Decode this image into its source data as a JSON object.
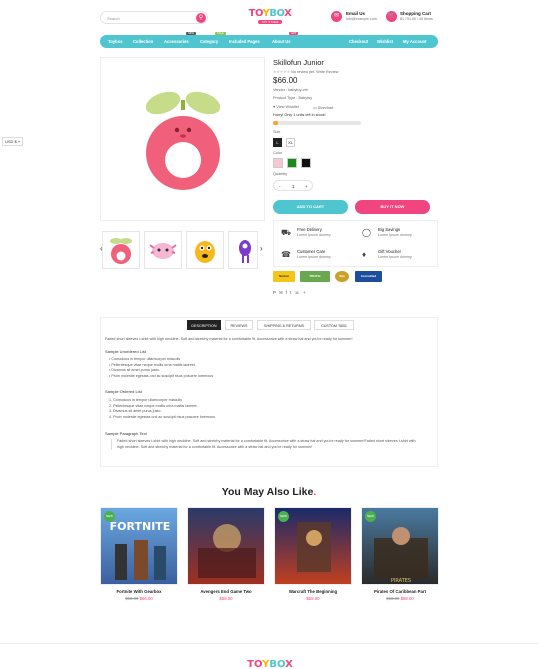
{
  "header": {
    "search_placeholder": "Search",
    "logo_text": "TOYBOX",
    "logo_sub": "TOY STORE",
    "email_title": "Email Us",
    "email_value": "info@example.com",
    "cart_title": "Shopping Cart",
    "cart_value": "$1,791.00 / 45 Items"
  },
  "nav": {
    "items": [
      "Toybox",
      "Collection",
      "Accessories",
      "Category",
      "Included Pages",
      "About Us"
    ],
    "badges": {
      "accessories": "NEW",
      "category": "SALE",
      "about": "HOT"
    },
    "right": [
      "Checkout",
      "Wishlist",
      "My Account"
    ]
  },
  "currency": "USD $",
  "product": {
    "title": "Skillofun Junior",
    "review_text": "No review yet. Write Review",
    "price": "$66.00",
    "vendor": "Vendor : babytoy-vtn",
    "type": "Product Type : Babytoy",
    "wishlist": "View Wishlist",
    "sizechart": "Sizechart",
    "hurry": "Hurry! Only 1 units left in stock!",
    "stock_fraction": 0.06,
    "size_label": "Size",
    "sizes": [
      "L",
      "XL"
    ],
    "color_label": "Color",
    "colors": [
      "#f7c8d3",
      "#1a8a1a",
      "#111111"
    ],
    "quantity_label": "Quantity",
    "qty_minus": "-",
    "qty_value": "1",
    "qty_plus": "+",
    "add_to_cart": "ADD TO CART",
    "buy_now": "BUY IT NOW"
  },
  "features": [
    {
      "title": "Free Delivery",
      "text": "Lorem Ipsum dummy"
    },
    {
      "title": "Big Savings",
      "text": "Lorem Ipsum dummy"
    },
    {
      "title": "Customer Care",
      "text": "Lorem Ipsum dummy"
    },
    {
      "title": "Gift Voucher",
      "text": "Lorem Ipsum dummy"
    }
  ],
  "trust_badges": [
    "Norton",
    "TRUSTe",
    "Site Secure",
    "Accredited"
  ],
  "tabs": [
    "DESCRIPTION",
    "REVIEWS",
    "SHIPPING & RETURNS",
    "CUSTOM TAB1"
  ],
  "description": {
    "intro": "Faded short sleeves t-shirt with high neckline. Soft and stretchy material for a comfortable fit. Accessorize with a straw hat and you're ready for summer!",
    "ul_title": "Sample Unordered List",
    "ul": [
      "Comodous in tempor ullamcorper miaculis",
      "Pellentesque vitae neque mollis urna mattis laoreet.",
      "Divamus sit amet purus justo.",
      "Proin molestie egestas orci ac suscipit risus posuere loremous"
    ],
    "ol_title": "Sample Ordered List",
    "ol": [
      "Comodous in tempor ullamcorper miaculis",
      "Pellentesque vitae neque mollis urna mattis laoreet.",
      "Divamus sit amet purus justo.",
      "Proin molestie egestas orci ac suscipit risus posuere loremous"
    ],
    "p_title": "Sample Paragraph Text",
    "p": "Faded short sleeves t-shirt with high neckline. Soft and stretchy material for a comfortable fit. Accessorize with a straw hat and you're ready for summer!Faded short sleeves t-shirt with high neckline. Soft and stretchy material for a comfortable fit. Accessorize with a straw hat and you're ready for summer!"
  },
  "related": {
    "title": "You May Also Like",
    "items": [
      {
        "name": "Fortnite With Gearbox",
        "old": "$68.00",
        "price": "$66.00",
        "badge": "NEW"
      },
      {
        "name": "Avengers End Game Two",
        "old": "",
        "price": "$58.00",
        "badge": ""
      },
      {
        "name": "Warcraft The Beginning",
        "old": "",
        "price": "$58.00",
        "badge": "NEW"
      },
      {
        "name": "Pirates Of Caribbean Part",
        "old": "$68.00",
        "price": "$58.00",
        "badge": "NEW"
      }
    ]
  },
  "colors": {
    "accent_pink": "#f0457f",
    "accent_teal": "#4fc6cf"
  }
}
